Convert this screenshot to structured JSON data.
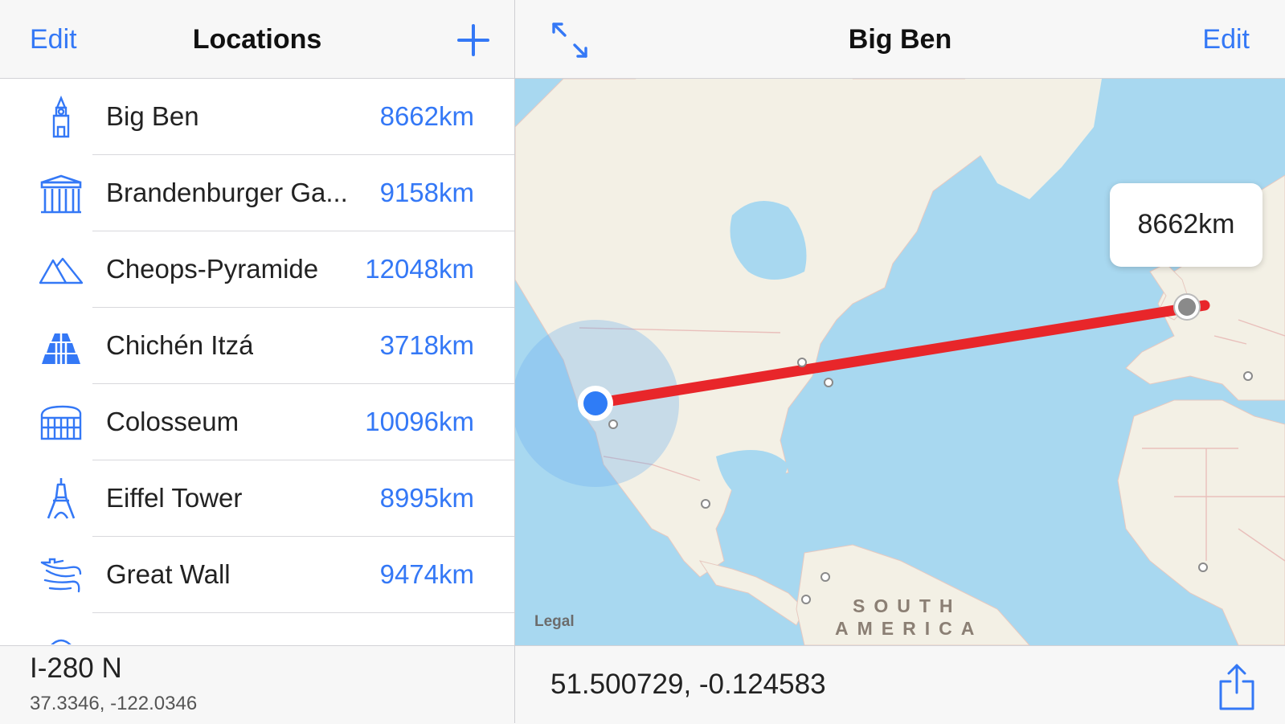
{
  "locations_panel": {
    "edit_label": "Edit",
    "title": "Locations",
    "add_icon": "plus-icon",
    "items": [
      {
        "name": "Big Ben",
        "distance": "8662km",
        "icon": "big-ben-icon"
      },
      {
        "name": "Brandenburger Ga...",
        "distance": "9158km",
        "icon": "brandenburg-gate-icon"
      },
      {
        "name": "Cheops-Pyramide",
        "distance": "12048km",
        "icon": "pyramid-icon"
      },
      {
        "name": "Chichén Itzá",
        "distance": "3718km",
        "icon": "chichen-itza-icon"
      },
      {
        "name": "Colosseum",
        "distance": "10096km",
        "icon": "colosseum-icon"
      },
      {
        "name": "Eiffel Tower",
        "distance": "8995km",
        "icon": "eiffel-tower-icon"
      },
      {
        "name": "Great Wall",
        "distance": "9474km",
        "icon": "great-wall-icon"
      }
    ],
    "current_location": {
      "road": "I-280 N",
      "coordinates": "37.3346, -122.0346"
    }
  },
  "detail_panel": {
    "expand_icon": "expand-arrows-icon",
    "title": "Big Ben",
    "edit_label": "Edit",
    "map": {
      "distance_callout": "8662km",
      "legal_label": "Legal",
      "continent_label_line1": "SOUTH",
      "continent_label_line2": "AMERICA"
    },
    "target_coordinates": "51.500729, -0.124583",
    "share_icon": "share-icon"
  },
  "colors": {
    "accent": "#3478f6",
    "route": "#e8262a",
    "water": "#a8d8f0",
    "land": "#f3f0e5"
  }
}
